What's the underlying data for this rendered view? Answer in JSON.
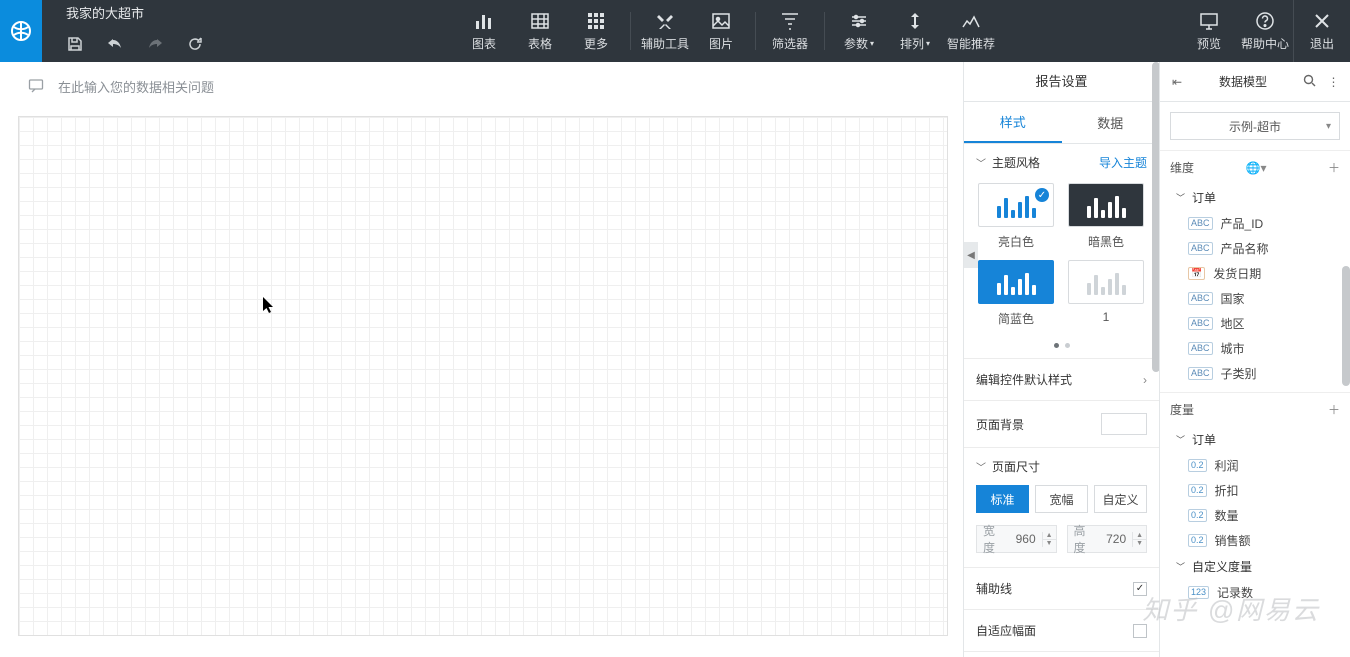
{
  "app": {
    "title": "我家的大超市"
  },
  "quick": {
    "save": "保存",
    "undo": "撤销",
    "redo": "重做",
    "refresh": "刷新"
  },
  "toolbar": {
    "chart": "图表",
    "table": "表格",
    "more": "更多",
    "tools": "辅助工具",
    "image": "图片",
    "filter": "筛选器",
    "param": "参数",
    "arrange": "排列",
    "smart": "智能推荐",
    "preview": "预览",
    "help": "帮助中心",
    "exit": "退出"
  },
  "ask_placeholder": "在此输入您的数据相关问题",
  "settings": {
    "title": "报告设置",
    "tabs": {
      "style": "样式",
      "data": "数据"
    },
    "theme": {
      "label": "主题风格",
      "import": "导入主题",
      "light": "亮白色",
      "dark": "暗黑色",
      "blue": "简蓝色",
      "one": "1"
    },
    "ctrl_style": "编辑控件默认样式",
    "bg": "页面背景",
    "size": {
      "label": "页面尺寸",
      "std": "标准",
      "wide": "宽幅",
      "custom": "自定义",
      "wlabel": "宽度",
      "hlabel": "高度",
      "w": "960",
      "h": "720"
    },
    "guide": "辅助线",
    "snap": "自适应幅面"
  },
  "model": {
    "title": "数据模型",
    "source": "示例-超市",
    "dim": "维度",
    "meas": "度量",
    "order": "订单",
    "dims": [
      {
        "t": "abc",
        "n": "产品_ID"
      },
      {
        "t": "abc",
        "n": "产品名称"
      },
      {
        "t": "cal",
        "n": "发货日期"
      },
      {
        "t": "abc",
        "n": "国家"
      },
      {
        "t": "abc",
        "n": "地区"
      },
      {
        "t": "abc",
        "n": "城市"
      },
      {
        "t": "abc",
        "n": "子类别"
      }
    ],
    "meass": [
      {
        "t": "num",
        "n": "利润"
      },
      {
        "t": "num",
        "n": "折扣"
      },
      {
        "t": "num",
        "n": "数量"
      },
      {
        "t": "num",
        "n": "销售额"
      }
    ],
    "custom": "自定义度量",
    "record": {
      "t": "123",
      "n": "记录数"
    }
  },
  "watermark": "知乎 @网易云"
}
